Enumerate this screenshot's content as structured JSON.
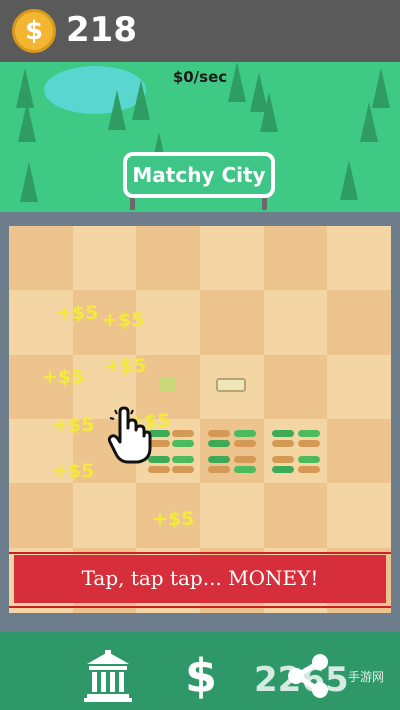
{
  "header": {
    "coin_icon": "dollar-coin-icon",
    "coin_symbol": "$",
    "coins": "218"
  },
  "income": {
    "rate": "$0/sec"
  },
  "city": {
    "name": "Matchy City"
  },
  "board": {
    "grid_size": 6,
    "popups": [
      "+$5",
      "+$5",
      "+$5",
      "+$5",
      "+$5",
      "+$5",
      "+$5",
      "+$5"
    ]
  },
  "banner": {
    "text": "Tap, tap tap... MONEY!"
  },
  "bottom_nav": {
    "items": [
      {
        "name": "bank",
        "icon": "bank-building-icon"
      },
      {
        "name": "money",
        "icon": "dollar-icon",
        "glyph": "$"
      },
      {
        "name": "share",
        "icon": "share-icon"
      }
    ]
  },
  "watermark": {
    "main": "2265",
    "sub": "手游网"
  },
  "colors": {
    "top_bar": "#5a5a5a",
    "grass": "#3ec984",
    "coin": "#f2b632",
    "banner": "#d62e3a",
    "popup": "#f4ea3c"
  }
}
